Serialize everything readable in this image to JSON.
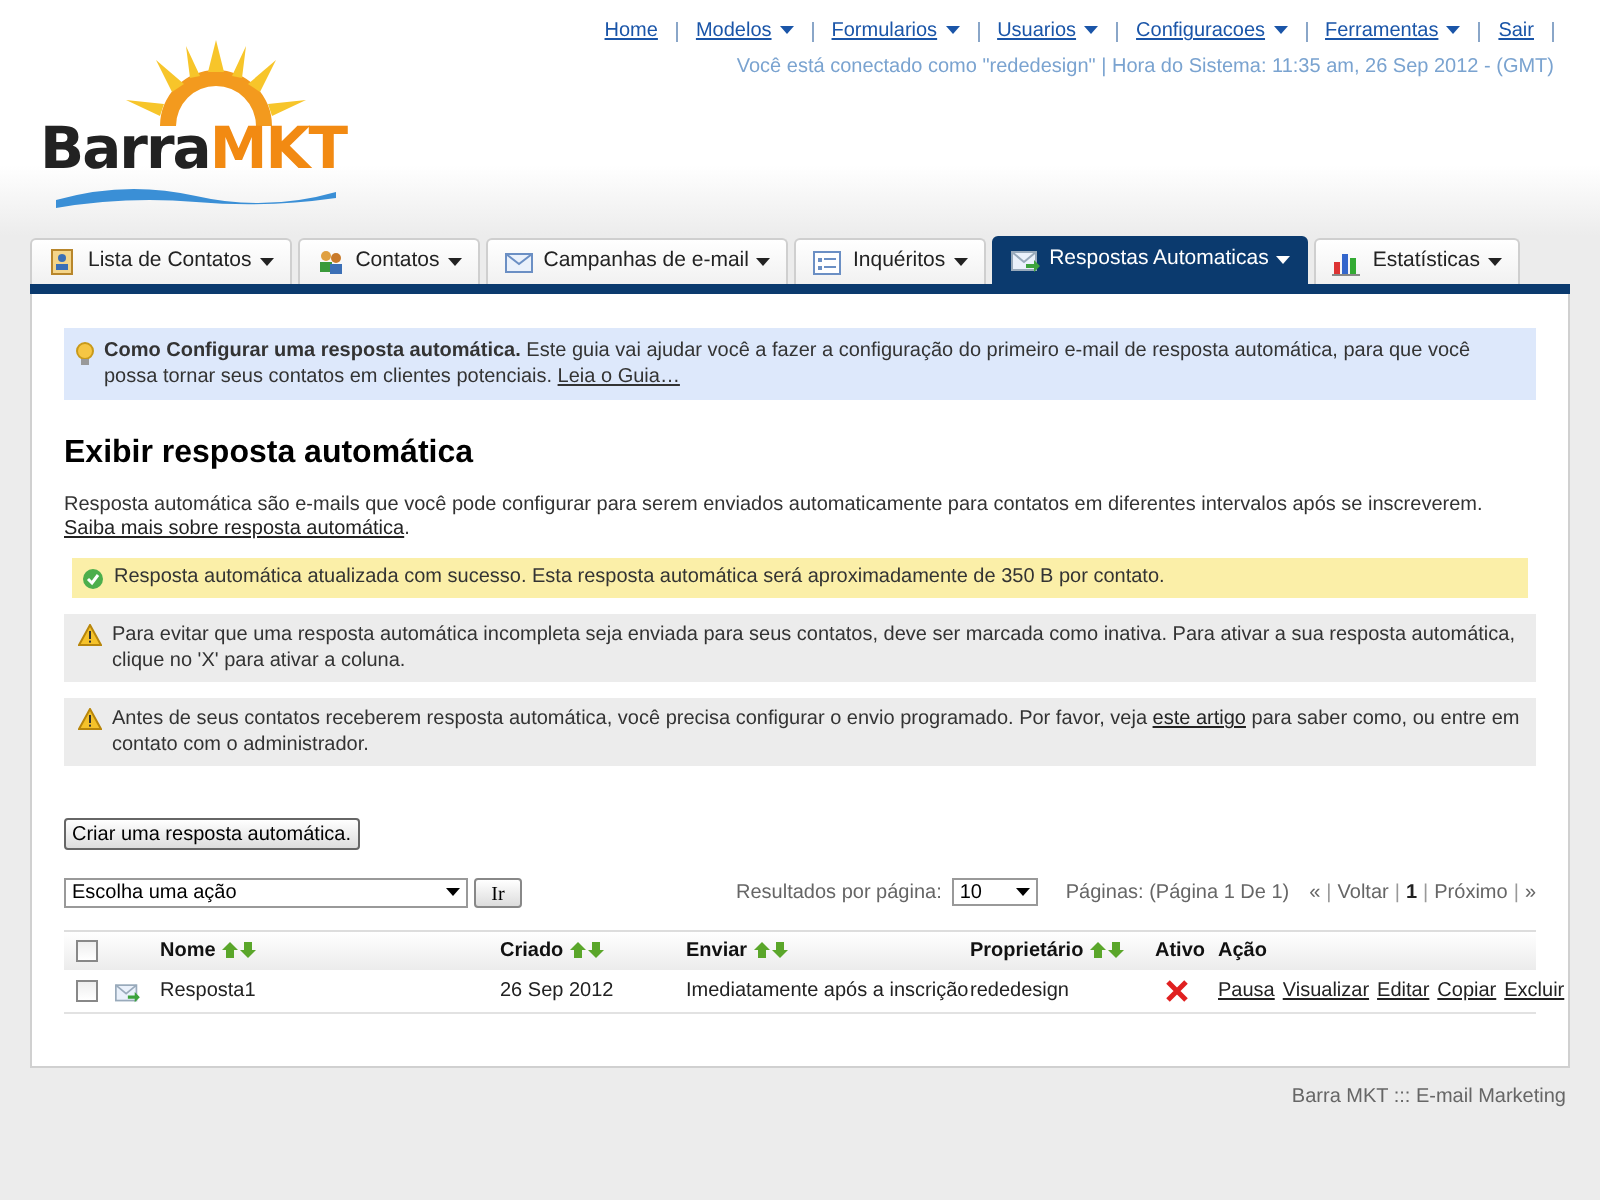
{
  "top_nav": [
    {
      "label": "Home",
      "dropdown": false
    },
    {
      "label": "Modelos",
      "dropdown": true
    },
    {
      "label": "Formularios",
      "dropdown": true
    },
    {
      "label": "Usuarios",
      "dropdown": true
    },
    {
      "label": "Configuracoes",
      "dropdown": true
    },
    {
      "label": "Ferramentas",
      "dropdown": true
    },
    {
      "label": "Sair",
      "dropdown": false
    }
  ],
  "session_info": "Você está conectado como \"rededesign\" | Hora do Sistema: 11:35 am, 26 Sep 2012 - (GMT)",
  "logo": {
    "first": "Barra",
    "second": "MKT"
  },
  "tabs": [
    {
      "label": "Lista de Contatos",
      "selected": false
    },
    {
      "label": "Contatos",
      "selected": false
    },
    {
      "label": "Campanhas de e-mail",
      "selected": false
    },
    {
      "label": "Inquéritos",
      "selected": false
    },
    {
      "label": "Respostas Automaticas",
      "selected": true
    },
    {
      "label": "Estatísticas",
      "selected": false
    }
  ],
  "guide": {
    "text": "**Como Configurar uma resposta automática.** Este guia vai ajudar você a fazer a configuração do primeiro e-mail de resposta automática, para que você possa tornar seus contatos em clientes potenciais.",
    "link": "Leia o Guia…"
  },
  "heading": "Exibir resposta automática",
  "intro": {
    "text": "Resposta automática são e-mails que você pode configurar para serem enviados automaticamente para contatos em diferentes intervalos após se inscreverem.",
    "link": "Saiba mais sobre resposta automática",
    "after": "."
  },
  "notices": [
    {
      "kind": "success",
      "text": "Resposta automática atualizada com sucesso. Esta resposta automática será aproximadamente de 350 B por contato."
    },
    {
      "kind": "warning",
      "text": "Para evitar que uma resposta automática incompleta seja enviada para seus contatos, deve ser marcada como inativa. Para ativar a sua resposta automática, clique no 'X' para ativar a coluna."
    },
    {
      "kind": "warning",
      "text": "Antes de seus contatos receberem resposta automática, você precisa configurar o envio programado. Por favor, veja",
      "link": "este artigo",
      "after": "para saber como, ou entre em contato com o administrador."
    }
  ],
  "create_button": "Criar uma resposta automática.",
  "action_select": {
    "value": "Escolha uma ação"
  },
  "go_button": "Ir",
  "per_page": {
    "label": "Resultados por página:",
    "value": "10"
  },
  "pages_info": "Páginas: (Página 1 De 1)",
  "pagination": [
    {
      "kind": "link",
      "label": "«"
    },
    {
      "kind": "sep",
      "label": "|"
    },
    {
      "kind": "link",
      "label": "Voltar"
    },
    {
      "kind": "sep",
      "label": "|"
    },
    {
      "kind": "current",
      "label": "1"
    },
    {
      "kind": "sep",
      "label": "|"
    },
    {
      "kind": "link",
      "label": "Próximo"
    },
    {
      "kind": "sep",
      "label": "|"
    },
    {
      "kind": "link",
      "label": "»"
    }
  ],
  "table": {
    "select_all_checked": false,
    "columns": [
      {
        "label": "Nome",
        "sortable": true
      },
      {
        "label": "Criado",
        "sortable": true
      },
      {
        "label": "Enviar",
        "sortable": true
      },
      {
        "label": "Proprietário",
        "sortable": true
      },
      {
        "label": "Ativo",
        "sortable": false
      },
      {
        "label": "Ação",
        "sortable": false
      }
    ],
    "rows": [
      {
        "checked": false,
        "name": "Resposta1",
        "created": "26 Sep 2012",
        "send": "Imediatamente após a inscrição",
        "owner": "rededesign",
        "active": false,
        "actions": [
          "Pausa",
          "Visualizar",
          "Editar",
          "Copiar",
          "Excluir"
        ]
      }
    ]
  },
  "footer": "Barra MKT ::: E-mail Marketing"
}
